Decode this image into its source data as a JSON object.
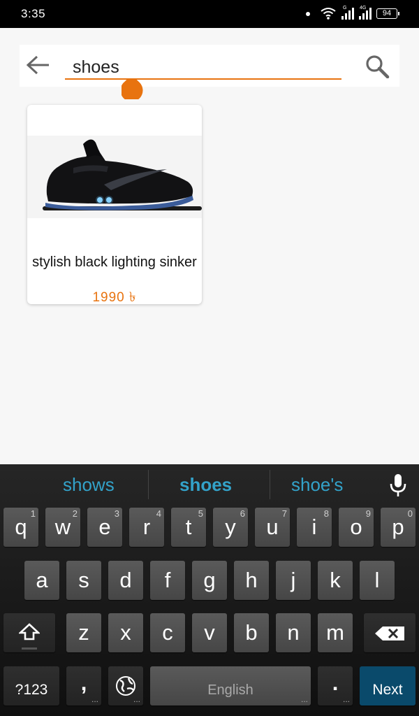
{
  "status_bar": {
    "time": "3:35",
    "wifi_icon": "wifi-icon",
    "sim1_tag": "G",
    "sim2_tag": "4G",
    "battery": "94"
  },
  "search": {
    "query": "shoes",
    "back_icon": "arrow-left-icon",
    "search_icon": "search-icon",
    "accent_color": "#e8730f"
  },
  "products": [
    {
      "name": "stylish black lighting sinker",
      "price": "1990 ৳",
      "image": "black-sneaker-with-lights"
    }
  ],
  "keyboard": {
    "suggestions": [
      "shows",
      "shoes",
      "shoe's"
    ],
    "suggestion_color": "#33a2c9",
    "mic_icon": "microphone-icon",
    "row1": [
      {
        "char": "q",
        "hint": "1"
      },
      {
        "char": "w",
        "hint": "2"
      },
      {
        "char": "e",
        "hint": "3"
      },
      {
        "char": "r",
        "hint": "4"
      },
      {
        "char": "t",
        "hint": "5"
      },
      {
        "char": "y",
        "hint": "6"
      },
      {
        "char": "u",
        "hint": "7"
      },
      {
        "char": "i",
        "hint": "8"
      },
      {
        "char": "o",
        "hint": "9"
      },
      {
        "char": "p",
        "hint": "0"
      }
    ],
    "row2": [
      "a",
      "s",
      "d",
      "f",
      "g",
      "h",
      "j",
      "k",
      "l"
    ],
    "row3": [
      "z",
      "x",
      "c",
      "v",
      "b",
      "n",
      "m"
    ],
    "shift_icon": "shift-icon",
    "delete_icon": "backspace-icon",
    "num_label": "?123",
    "comma": ",",
    "globe_icon": "globe-icon",
    "space_label": "English",
    "period": ".",
    "next_label": "Next",
    "next_color": "#0a4a6b"
  }
}
